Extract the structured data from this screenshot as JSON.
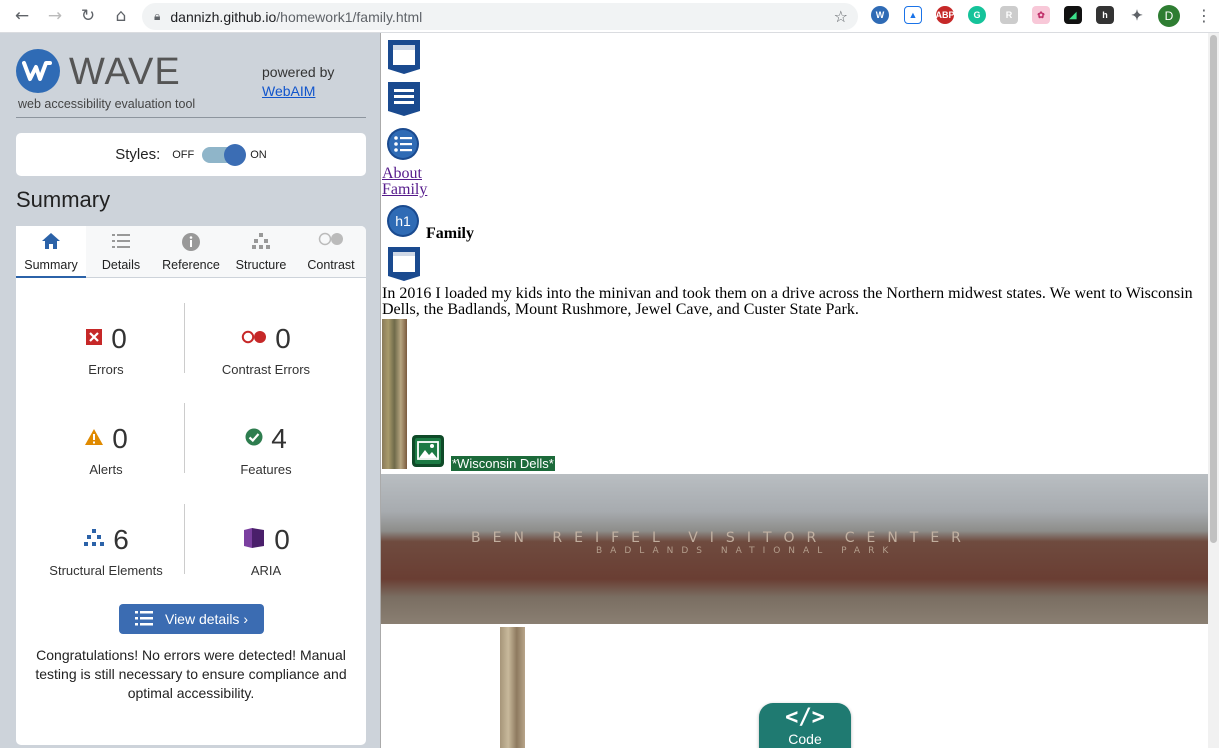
{
  "browser": {
    "url_host": "dannizh.github.io",
    "url_path": "/homework1/family.html",
    "profile_initial": "D"
  },
  "wave": {
    "title": "WAVE",
    "subtitle": "web accessibility evaluation tool",
    "powered_by": "powered by",
    "webaim_link": "WebAIM",
    "styles_label": "Styles:",
    "styles_off": "OFF",
    "styles_on": "ON",
    "summary_heading": "Summary",
    "tabs": [
      {
        "label": "Summary",
        "icon": "home-icon"
      },
      {
        "label": "Details",
        "icon": "list-icon"
      },
      {
        "label": "Reference",
        "icon": "info-icon"
      },
      {
        "label": "Structure",
        "icon": "hierarchy-icon"
      },
      {
        "label": "Contrast",
        "icon": "contrast-icon"
      }
    ],
    "stats": [
      {
        "label": "Errors",
        "value": "0",
        "icon": "error-icon"
      },
      {
        "label": "Contrast Errors",
        "value": "0",
        "icon": "contrast-error-icon"
      },
      {
        "label": "Alerts",
        "value": "0",
        "icon": "alert-icon"
      },
      {
        "label": "Features",
        "value": "4",
        "icon": "feature-icon"
      },
      {
        "label": "Structural Elements",
        "value": "6",
        "icon": "structure-icon"
      },
      {
        "label": "ARIA",
        "value": "0",
        "icon": "aria-icon"
      }
    ],
    "view_details": "View details ›",
    "congrats": "Congratulations! No errors were detected! Manual testing is still necessary to ensure compliance and optimal accessibility."
  },
  "page": {
    "nav_links": [
      "About",
      "Family"
    ],
    "heading": "Family",
    "h1_badge": "h1",
    "paragraph": "In 2016 I loaded my kids into the minivan and took them on a drive across the Northern midwest states. We went to Wisconsin Dells, the Badlands, Mount Rushmore, Jewel Cave, and Custer State Park.",
    "alt_text": "*Wisconsin Dells*",
    "sign_line1": "BEN REIFEL VISITOR CENTER",
    "sign_line2": "BADLANDS NATIONAL PARK",
    "code_label": "Code",
    "code_icon": "</>"
  },
  "colors": {
    "wave_blue": "#2f6bb5",
    "sidebar_bg": "#cdd3da",
    "feature_green": "#1c6a3a",
    "code_teal": "#1f7a71"
  }
}
